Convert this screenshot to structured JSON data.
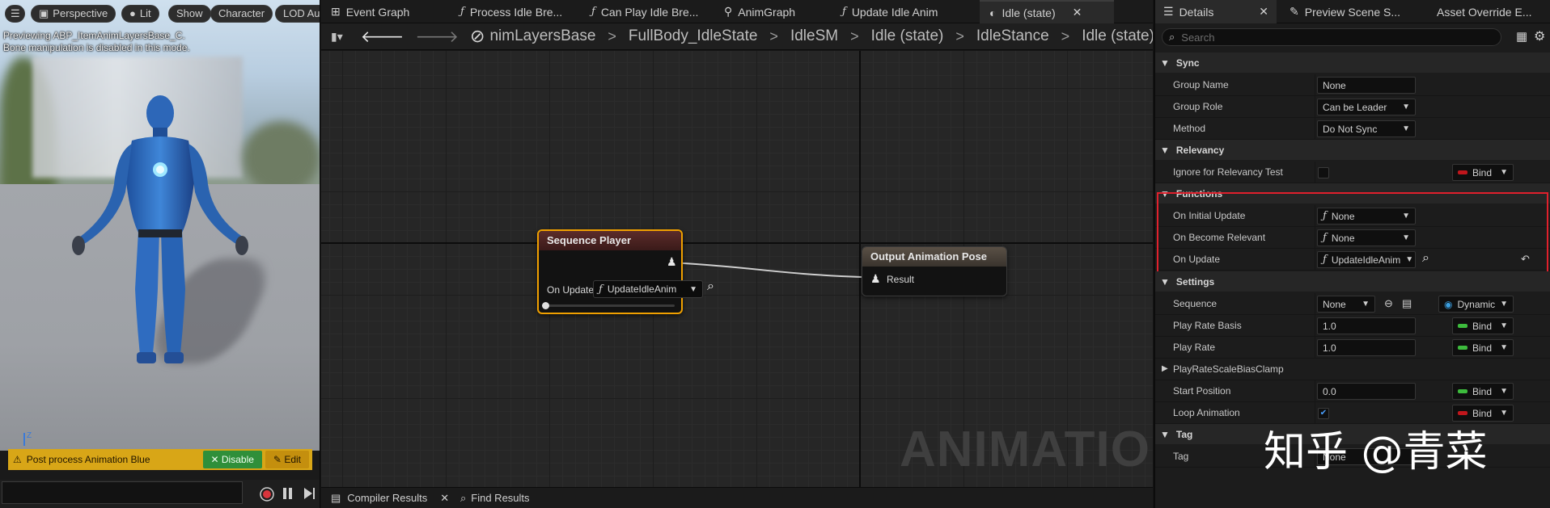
{
  "viewport": {
    "buttons": {
      "perspective": "Perspective",
      "lit": "Lit",
      "show": "Show",
      "character": "Character",
      "lod": "LOD Aut"
    },
    "info_line1": "Previewing ABP_ItemAnimLayersBase_C.",
    "info_line2": "Bone manipulation is disabled in this mode.",
    "axis_label": "Z",
    "warning": {
      "text": "Post process Animation Blue",
      "disable": "Disable",
      "edit": "Edit"
    }
  },
  "tabs": [
    {
      "label": "Event Graph",
      "icon": "graph-icon"
    },
    {
      "label": "Process Idle Bre...",
      "icon": "function-icon"
    },
    {
      "label": "Can Play Idle Bre...",
      "icon": "function-icon"
    },
    {
      "label": "AnimGraph",
      "icon": "anim-graph-icon"
    },
    {
      "label": "Update Idle Anim",
      "icon": "function-icon"
    },
    {
      "label": "Idle (state)",
      "icon": "state-icon"
    }
  ],
  "breadcrumb": [
    "nimLayersBase",
    "FullBody_IdleState",
    "IdleSM",
    "Idle (state)",
    "IdleStance",
    "Idle (state)"
  ],
  "graph": {
    "sequence_player": {
      "title": "Sequence Player",
      "pin_label": "On Update",
      "function": "UpdateIdleAnim"
    },
    "output_pose": {
      "title": "Output Animation Pose",
      "pin_label": "Result"
    },
    "watermark": "ANIMATION"
  },
  "bottom_tabs": {
    "compiler": "Compiler Results",
    "find": "Find Results"
  },
  "details": {
    "tabs": {
      "details": "Details",
      "preview": "Preview Scene S...",
      "override": "Asset Override E..."
    },
    "search_placeholder": "Search",
    "sections": {
      "sync": "Sync",
      "relevancy": "Relevancy",
      "functions": "Functions",
      "settings": "Settings",
      "tag": "Tag"
    },
    "rows": {
      "group_name": {
        "label": "Group Name",
        "value": "None"
      },
      "group_role": {
        "label": "Group Role",
        "value": "Can be Leader"
      },
      "method": {
        "label": "Method",
        "value": "Do Not Sync"
      },
      "ignore_relevancy": {
        "label": "Ignore for Relevancy Test",
        "bind": "Bind"
      },
      "on_initial_update": {
        "label": "On Initial Update",
        "value": "None"
      },
      "on_become_relevant": {
        "label": "On Become Relevant",
        "value": "None"
      },
      "on_update": {
        "label": "On Update",
        "value": "UpdateIdleAnim"
      },
      "sequence": {
        "label": "Sequence",
        "value": "None",
        "dynamic": "Dynamic"
      },
      "play_rate_basis": {
        "label": "Play Rate Basis",
        "value": "1.0",
        "bind": "Bind"
      },
      "play_rate": {
        "label": "Play Rate",
        "value": "1.0",
        "bind": "Bind"
      },
      "play_rate_clamp": {
        "label": "PlayRateScaleBiasClamp"
      },
      "start_position": {
        "label": "Start Position",
        "value": "0.0",
        "bind": "Bind"
      },
      "loop_animation": {
        "label": "Loop Animation",
        "bind": "Bind",
        "checked": true
      },
      "tag": {
        "label": "Tag",
        "value": "None"
      }
    }
  },
  "watermark_text": "知乎 @青菜",
  "colors": {
    "accent_orange": "#f0a000",
    "bind_red": "#c0161c",
    "bind_green": "#3dbb3d",
    "highlight": "#e0202c",
    "warning": "#d8a617"
  }
}
